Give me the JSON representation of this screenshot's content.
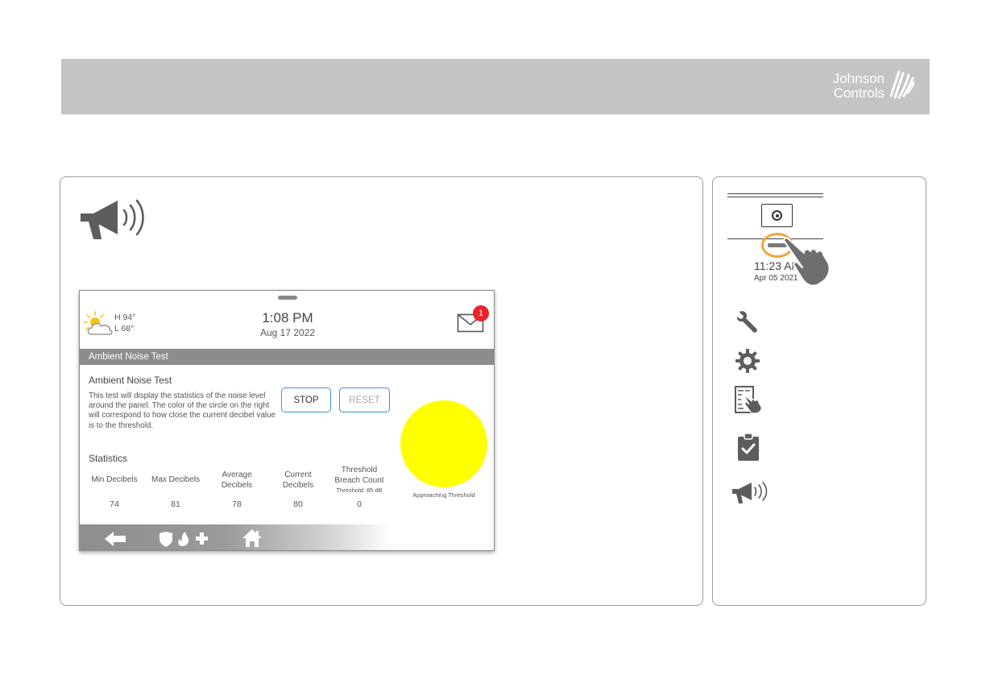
{
  "brand": {
    "line1": "Johnson",
    "line2": "Controls"
  },
  "panel": {
    "weather": {
      "high": "H 94°",
      "low": "L 68°"
    },
    "time": "1:08 PM",
    "date": "Aug 17 2022",
    "mail_badge": "1",
    "title": "Ambient Noise Test",
    "heading": "Ambient Noise Test",
    "description": "This test will display the statistics of the noise level around the panel. The color of the circle on the right will correspond to how close the current decibel value is to the threshold.",
    "stop_label": "STOP",
    "reset_label": "RESET",
    "circle_color": "#ffff00",
    "circle_caption": "Approaching Threshold",
    "statistics_heading": "Statistics",
    "stats": {
      "min": {
        "label": "Min Decibels",
        "value": "74"
      },
      "max": {
        "label": "Max Decibels",
        "value": "81"
      },
      "average": {
        "label_line1": "Average",
        "label_line2": "Decibels",
        "value": "78"
      },
      "current": {
        "label_line1": "Current",
        "label_line2": "Decibels",
        "value": "80"
      },
      "breach": {
        "label_line1": "Threshold",
        "label_line2": "Breach Count",
        "sub": "Threshold: 85 dB",
        "value": "0"
      }
    },
    "nav": {
      "back_icon": "back-arrow-icon",
      "emergency_icon": "emergency-icon",
      "home_icon": "home-icon"
    }
  },
  "side": {
    "time": "11:23 AM",
    "date": "Apr 05 2021",
    "ring_color": "#f4a33b",
    "icons": [
      "wrench-icon",
      "gear-icon",
      "touch-panel-icon",
      "clipboard-check-icon",
      "megaphone-icon"
    ]
  }
}
